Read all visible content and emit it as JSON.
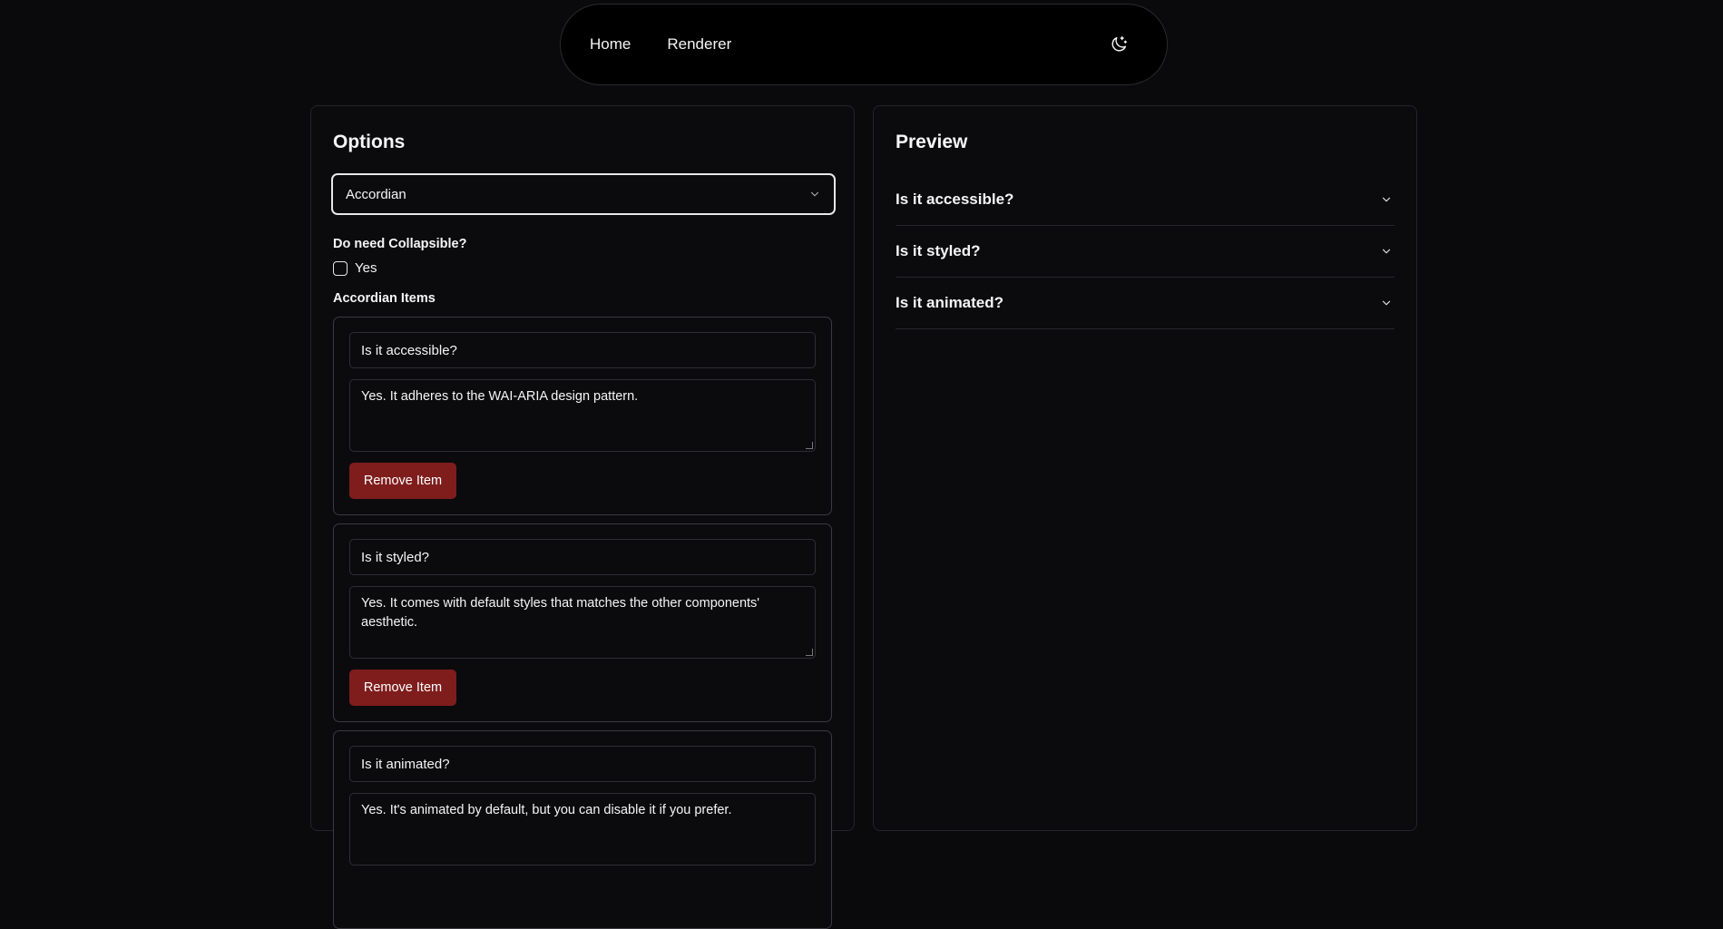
{
  "nav": {
    "links": [
      "Home",
      "Renderer"
    ],
    "theme_icon": "moon-stars-icon"
  },
  "options": {
    "title": "Options",
    "component_select": "Accordian",
    "collapsible_label": "Do need Collapsible?",
    "collapsible_option": "Yes",
    "collapsible_checked": false,
    "items_label": "Accordian Items",
    "remove_label": "Remove Item",
    "items": [
      {
        "title": "Is it accessible?",
        "content": "Yes. It adheres to the WAI-ARIA design pattern."
      },
      {
        "title": "Is it styled?",
        "content": "Yes. It comes with default styles that matches the other components' aesthetic."
      },
      {
        "title": "Is it animated?",
        "content": "Yes. It's animated by default, but you can disable it if you prefer."
      }
    ]
  },
  "preview": {
    "title": "Preview",
    "items": [
      "Is it accessible?",
      "Is it styled?",
      "Is it animated?"
    ]
  },
  "colors": {
    "background": "#0a0a0c",
    "remove_button": "#7f1d1d",
    "border": "#2e2e34"
  }
}
